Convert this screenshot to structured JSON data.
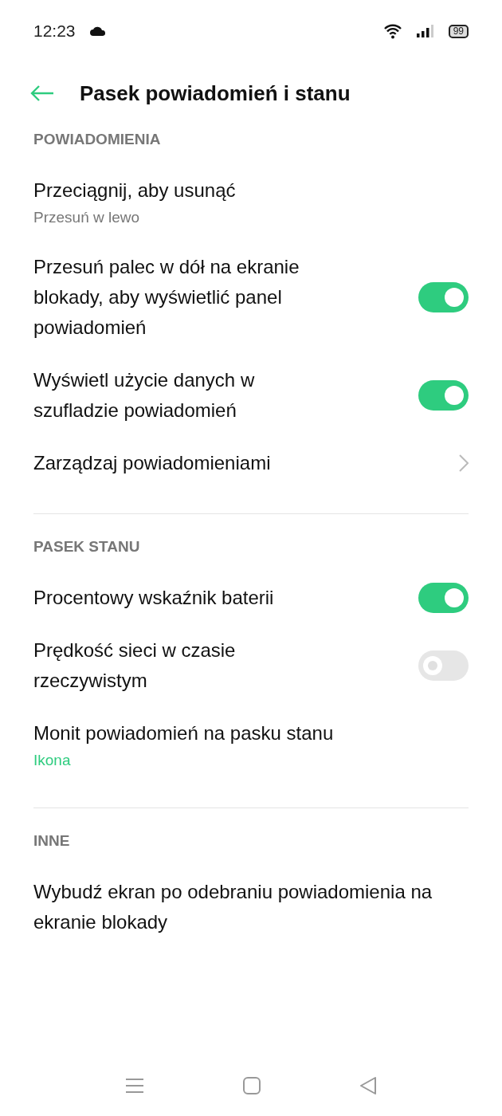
{
  "status_bar": {
    "time": "12:23",
    "battery": "99"
  },
  "header": {
    "title": "Pasek powiadomień i stanu"
  },
  "sections": [
    {
      "title": "POWIADOMIENIA",
      "items": [
        {
          "kind": "plain",
          "title": "Przeciągnij, aby usunąć",
          "subtitle": "Przesuń w lewo",
          "subtitle_accent": false
        },
        {
          "kind": "toggle",
          "title": "Przesuń palec w dół na ekranie blokady, aby wyświetlić panel powiadomień",
          "on": true
        },
        {
          "kind": "toggle",
          "title": "Wyświetl użycie danych w szufladzie powiadomień",
          "on": true
        },
        {
          "kind": "link",
          "title": "Zarządzaj powiadomieniami"
        }
      ]
    },
    {
      "title": "PASEK STANU",
      "items": [
        {
          "kind": "toggle",
          "title": "Procentowy wskaźnik baterii",
          "on": true
        },
        {
          "kind": "toggle",
          "title": "Prędkość sieci w czasie rzeczywistym",
          "on": false
        },
        {
          "kind": "plain",
          "title": "Monit powiadomień na pasku stanu",
          "subtitle": "Ikona",
          "subtitle_accent": true
        }
      ]
    },
    {
      "title": "INNE",
      "items": [
        {
          "kind": "plain",
          "title": "Wybudź ekran po odebraniu powiadomienia na ekranie blokady"
        }
      ]
    }
  ]
}
